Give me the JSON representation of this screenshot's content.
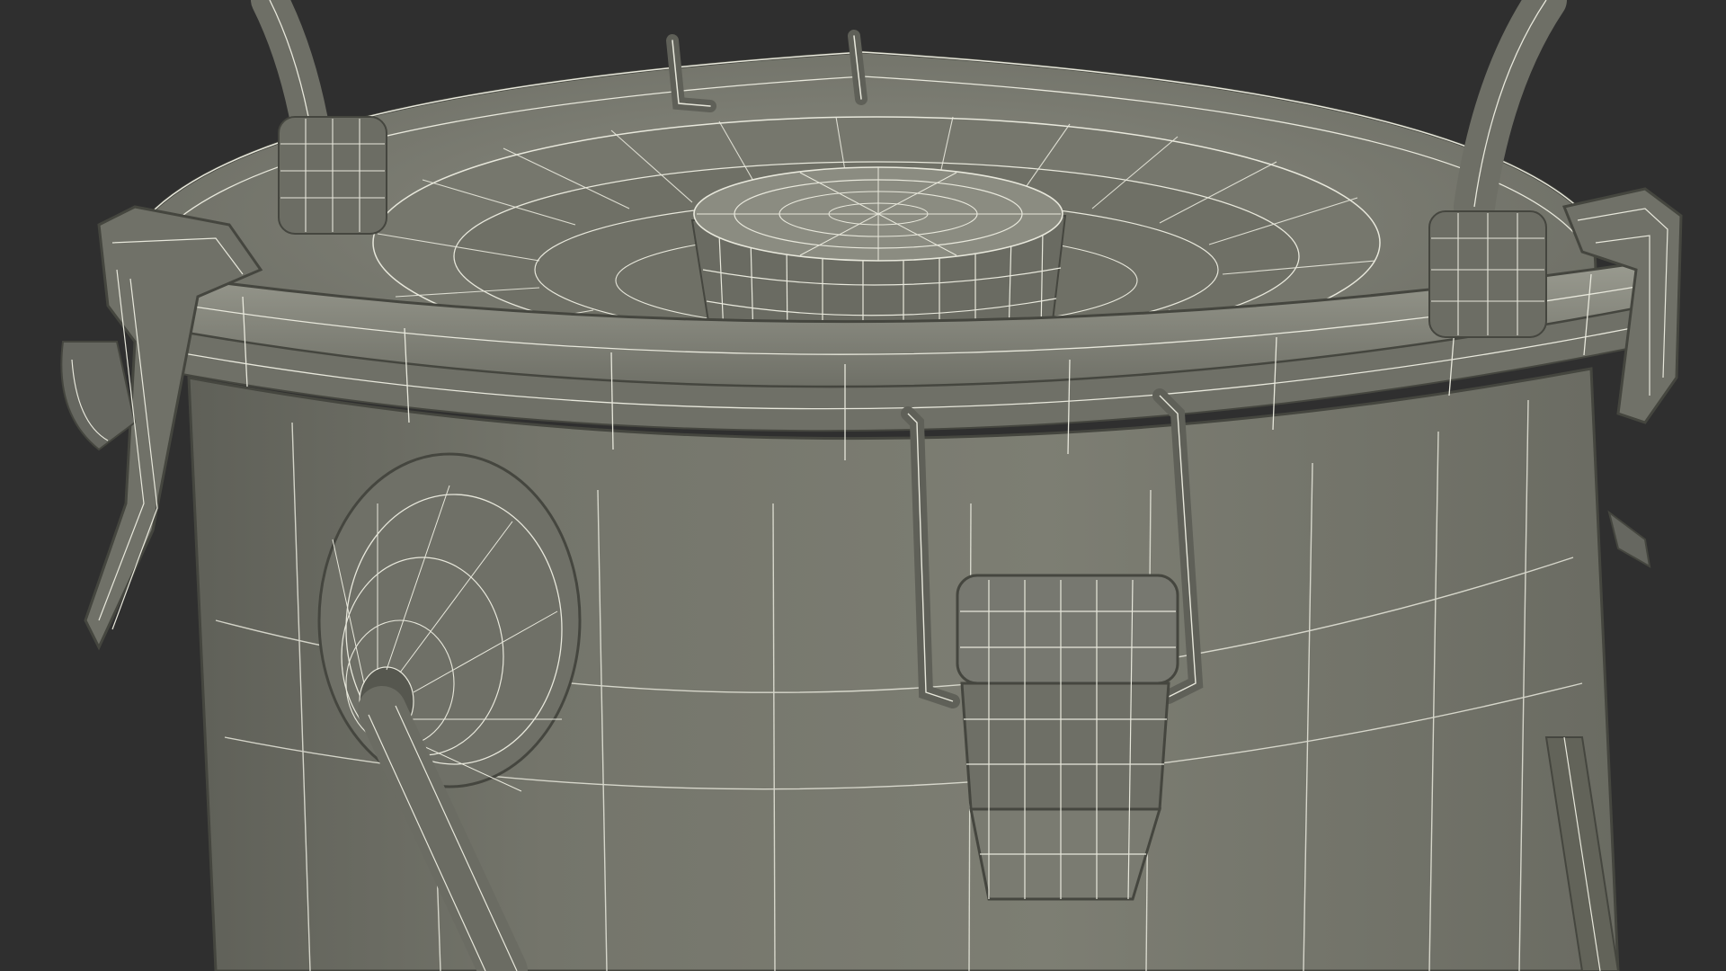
{
  "scene": {
    "subject": "wireframe-pressure-tank-lid",
    "colors": {
      "background": "#2f2f2f",
      "surface": "#7c7d72",
      "surface_dark": "#62635a",
      "surface_light": "#8f9085",
      "wire": "#e8e8dc",
      "edge": "#45463f"
    }
  }
}
